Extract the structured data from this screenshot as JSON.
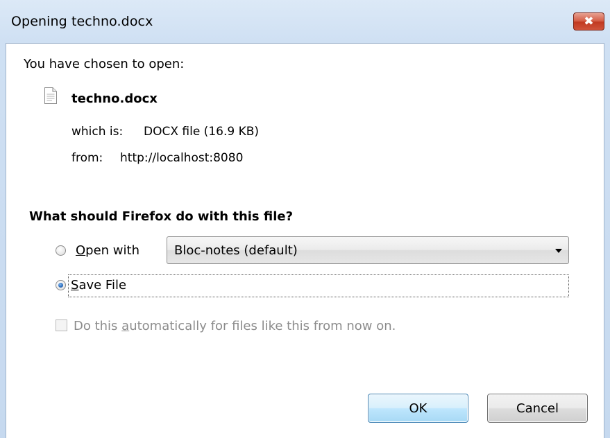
{
  "window": {
    "title": "Opening techno.docx",
    "close_glyph": "✖"
  },
  "file": {
    "intro": "You have chosen to open:",
    "name": "techno.docx",
    "icon": "document-icon",
    "which_label": "which is:",
    "which_value": "DOCX file (16.9 KB)",
    "from_label": "from:",
    "from_value": "http://localhost:8080"
  },
  "action": {
    "question": "What should Firefox do with this file?",
    "open_with": {
      "mnemonic": "O",
      "rest": "pen with",
      "selected": false
    },
    "application": {
      "selected_value": "Bloc-notes (default)"
    },
    "save_file": {
      "mnemonic": "S",
      "rest": "ave File",
      "selected": true
    },
    "auto": {
      "before": "Do this ",
      "mnemonic": "a",
      "after": "utomatically for files like this from now on.",
      "checked": false,
      "enabled": false
    }
  },
  "buttons": {
    "ok_label": "OK",
    "cancel_label": "Cancel"
  },
  "colors": {
    "title_bar": "#dce9f7",
    "close_button": "#c13a22",
    "ok_border": "#3c7fb1",
    "disabled_text": "#8c8c8c"
  }
}
